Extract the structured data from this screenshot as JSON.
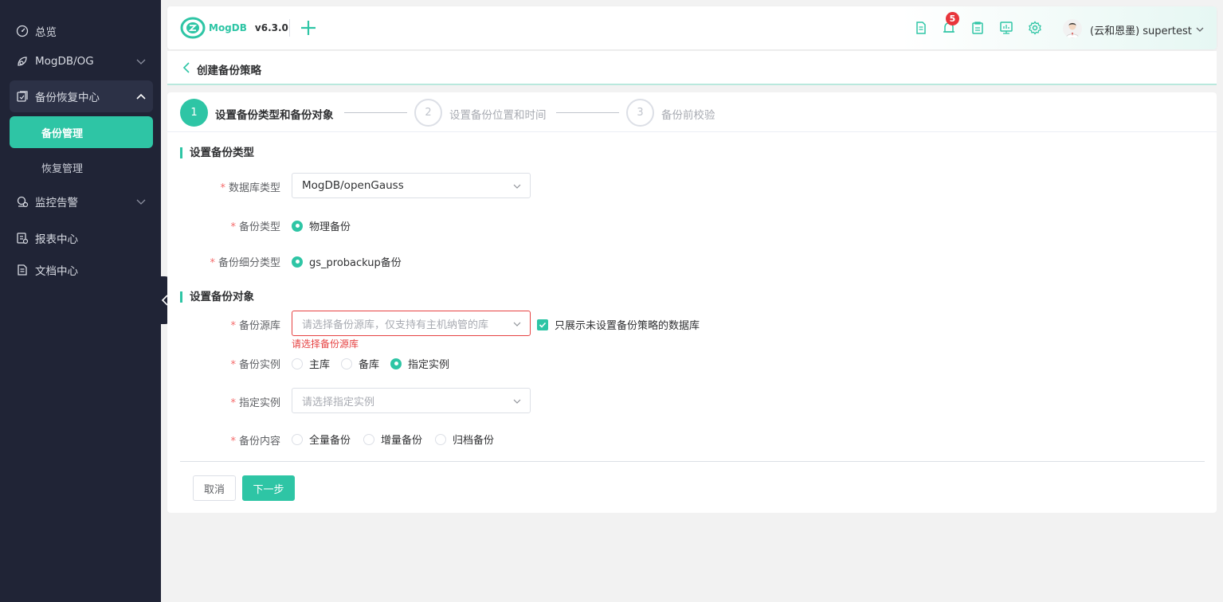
{
  "sidebar": {
    "items": [
      {
        "label": "总览"
      },
      {
        "label": "MogDB/OG"
      },
      {
        "label": "备份恢复中心"
      },
      {
        "label": "监控告警"
      },
      {
        "label": "报表中心"
      },
      {
        "label": "文档中心"
      }
    ],
    "sub_items": [
      {
        "label": "备份管理"
      },
      {
        "label": "恢复管理"
      }
    ]
  },
  "header": {
    "brand": "MogDB",
    "version": "v6.3.0",
    "notification_count": "5",
    "username": "(云和恩墨) supertest"
  },
  "breadcrumb": {
    "title": "创建备份策略"
  },
  "steps": [
    {
      "number": "1",
      "label": "设置备份类型和备份对象"
    },
    {
      "number": "2",
      "label": "设置备份位置和时间"
    },
    {
      "number": "3",
      "label": "备份前校验"
    }
  ],
  "section_type": {
    "title": "设置备份类型",
    "db_type_label": "数据库类型",
    "db_type_value": "MogDB/openGauss",
    "backup_type_label": "备份类型",
    "backup_type_option": "物理备份",
    "sub_type_label": "备份细分类型",
    "sub_type_option": "gs_probackup备份"
  },
  "section_object": {
    "title": "设置备份对象",
    "source_label": "备份源库",
    "source_placeholder": "请选择备份源库，仅支持有主机纳管的库",
    "source_error": "请选择备份源库",
    "only_unset_label": "只展示未设置备份策略的数据库",
    "instance_label": "备份实例",
    "instance_options": [
      "主库",
      "备库",
      "指定实例"
    ],
    "instance_selected": "指定实例",
    "specified_label": "指定实例",
    "specified_placeholder": "请选择指定实例",
    "content_label": "备份内容",
    "content_options": [
      "全量备份",
      "增量备份",
      "归档备份"
    ]
  },
  "footer": {
    "cancel_label": "取消",
    "next_label": "下一步"
  },
  "colors": {
    "accent": "#2ec5a5",
    "sidebar_bg": "#202436",
    "error": "#e64242",
    "badge": "#e8363c"
  }
}
